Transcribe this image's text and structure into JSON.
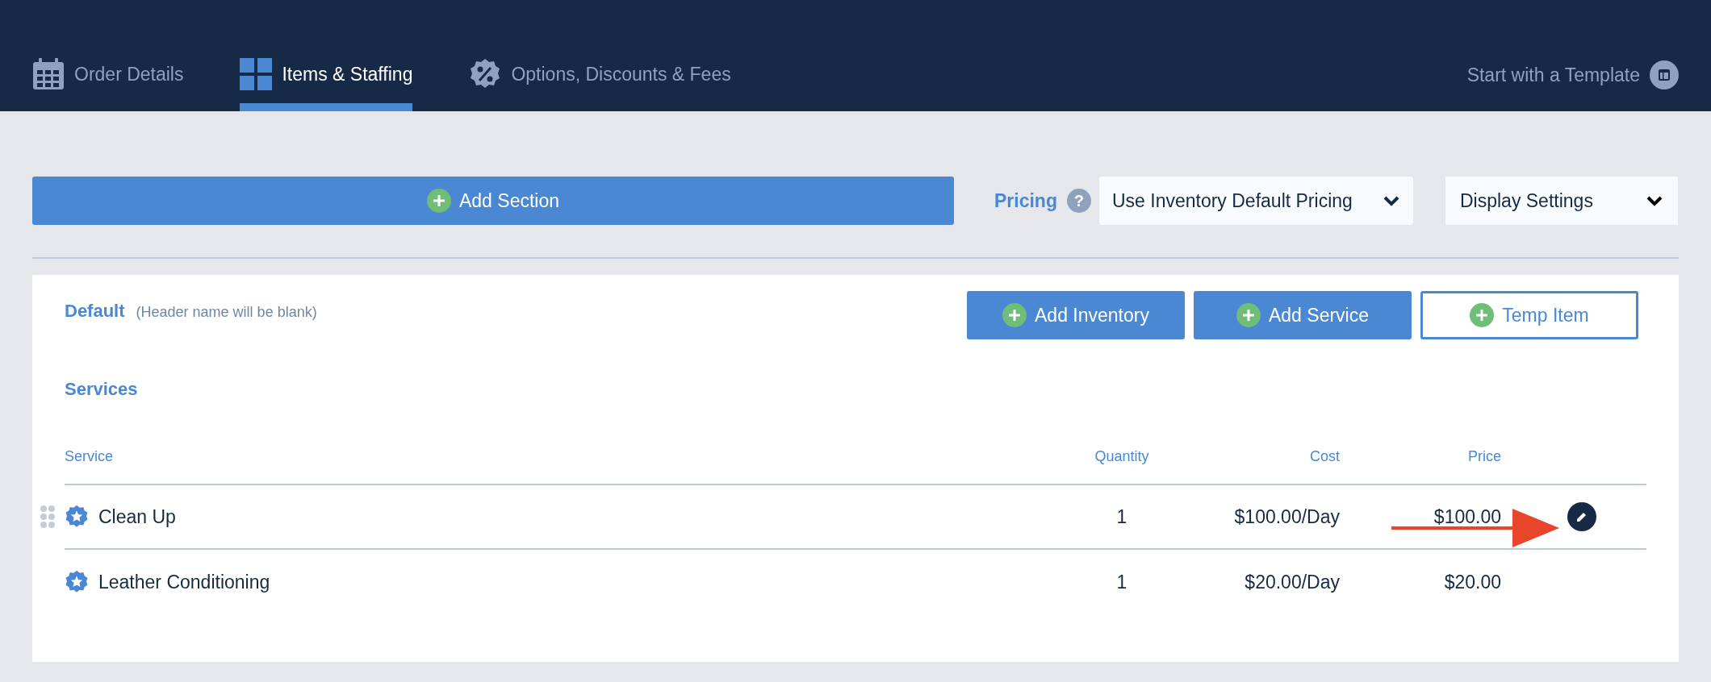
{
  "tabs": [
    {
      "label": "Order Details",
      "selected": false
    },
    {
      "label": "Items & Staffing",
      "selected": true
    },
    {
      "label": "Options, Discounts & Fees",
      "selected": false
    }
  ],
  "template_link": "Start with a Template",
  "toolbar": {
    "add_section": "Add Section",
    "pricing_label": "Pricing",
    "help": "?",
    "pricing_select": "Use Inventory Default Pricing",
    "display_select": "Display Settings"
  },
  "section": {
    "name": "Default",
    "note": "(Header name will be blank)",
    "buttons": [
      {
        "label": "Add Inventory",
        "kind": "filled"
      },
      {
        "label": "Add Service",
        "kind": "filled"
      },
      {
        "label": "Temp Item",
        "kind": "outline"
      }
    ],
    "group_title": "Services",
    "columns": [
      "Service",
      "Quantity",
      "Cost",
      "Price"
    ],
    "rows": [
      {
        "name": "Clean Up",
        "quantity": "1",
        "cost": "$100.00/Day",
        "price": "$100.00",
        "hovered": true
      },
      {
        "name": "Leather Conditioning",
        "quantity": "1",
        "cost": "$20.00/Day",
        "price": "$20.00",
        "hovered": false
      }
    ]
  }
}
